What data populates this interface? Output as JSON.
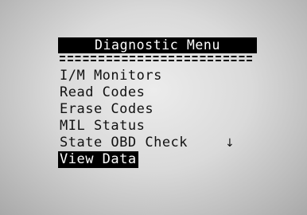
{
  "title": "Diagnostic Menu",
  "divider": "=========================",
  "menu": {
    "items": [
      {
        "label": "I/M Monitors"
      },
      {
        "label": "Read Codes"
      },
      {
        "label": "Erase Codes"
      },
      {
        "label": "MIL Status"
      },
      {
        "label": "State OBD Check"
      },
      {
        "label": "View Data"
      }
    ],
    "selected_index": 5
  },
  "scroll_indicator": "↓",
  "colors": {
    "highlight_bg": "#000000",
    "highlight_text": "#ffffff",
    "text": "#111111"
  }
}
